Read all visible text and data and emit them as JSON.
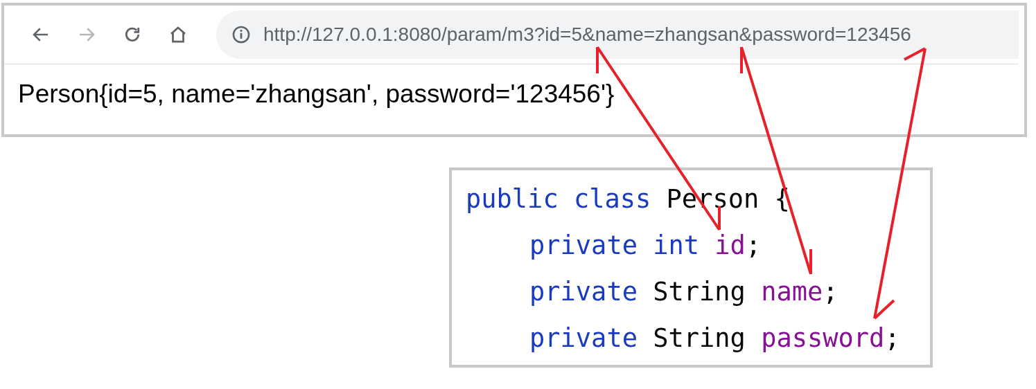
{
  "browser": {
    "nav_buttons": [
      {
        "kind": "back",
        "disabled": false
      },
      {
        "kind": "forward",
        "disabled": true
      },
      {
        "kind": "reload",
        "disabled": false
      },
      {
        "kind": "home",
        "disabled": false
      }
    ],
    "address": "http://127.0.0.1:8080/param/m3?id=5&name=zhangsan&password=123456",
    "content": "Person{id=5, name='zhangsan', password='123456'}"
  },
  "code": {
    "lines": [
      {
        "tokens": [
          {
            "text": "public class ",
            "kind": "keyword"
          },
          {
            "text": "Person {",
            "kind": "plain"
          }
        ],
        "children": [
          {
            "tokens": [
              {
                "text": "private int ",
                "kind": "keyword"
              },
              {
                "text": "id",
                "kind": "field"
              },
              {
                "text": ";",
                "kind": "plain"
              }
            ]
          },
          {
            "tokens": [
              {
                "text": "private ",
                "kind": "keyword"
              },
              {
                "text": "String ",
                "kind": "plain"
              },
              {
                "text": "name",
                "kind": "field"
              },
              {
                "text": ";",
                "kind": "plain"
              }
            ]
          },
          {
            "tokens": [
              {
                "text": "private ",
                "kind": "keyword"
              },
              {
                "text": "String ",
                "kind": "plain"
              },
              {
                "text": "password",
                "kind": "field"
              },
              {
                "text": ";",
                "kind": "plain"
              }
            ]
          }
        ]
      }
    ]
  }
}
